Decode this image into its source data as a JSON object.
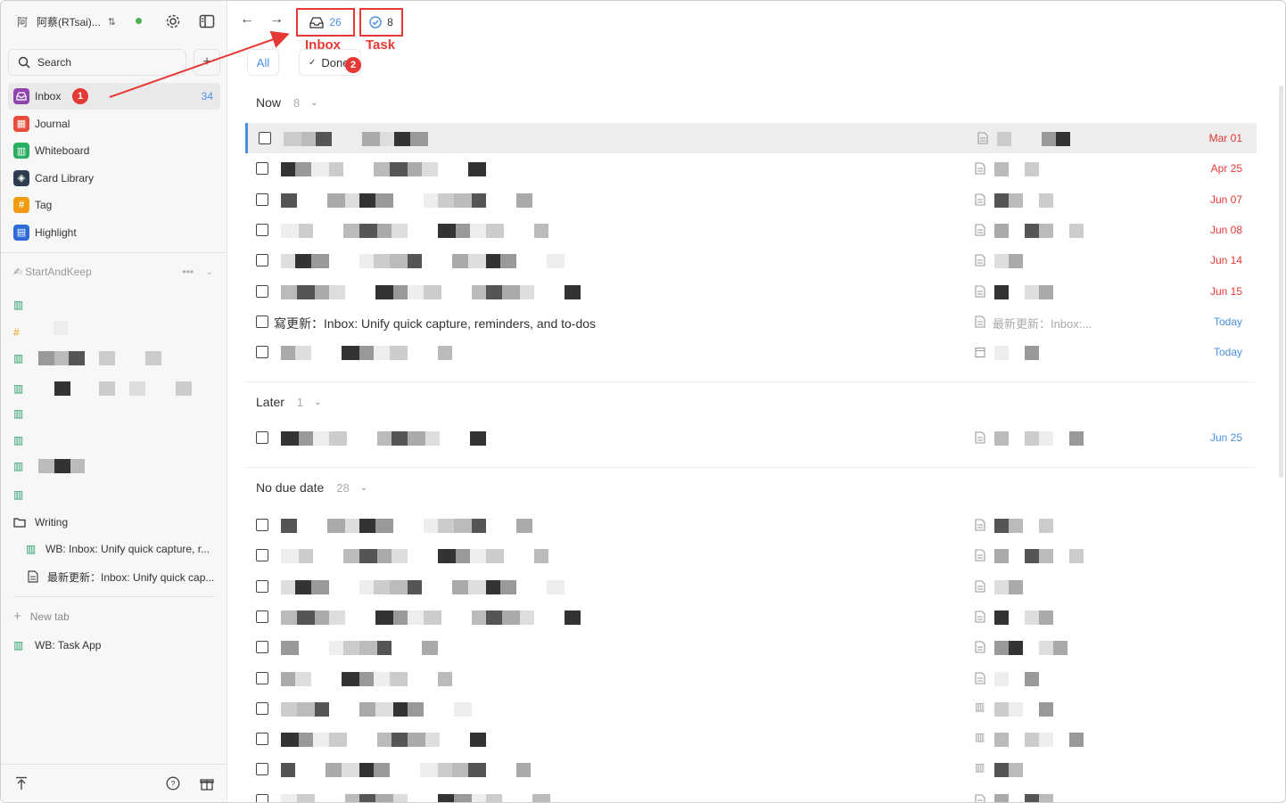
{
  "workspace": {
    "avatar": "阿",
    "name": "阿蔡(RTsai)..."
  },
  "search": {
    "label": "Search"
  },
  "sidebar": {
    "items": [
      {
        "label": "Inbox",
        "count": "34",
        "icon": "inbox-icon",
        "color": "#8e44ad"
      },
      {
        "label": "Journal",
        "icon": "journal-icon",
        "color": "#e74c3c"
      },
      {
        "label": "Whiteboard",
        "icon": "whiteboard-icon",
        "color": "#27ae60"
      },
      {
        "label": "Card Library",
        "icon": "card-library-icon",
        "color": "#2c3e50"
      },
      {
        "label": "Tag",
        "icon": "tag-icon",
        "color": "#f39c12"
      },
      {
        "label": "Highlight",
        "icon": "highlight-icon",
        "color": "#2e6bd9"
      }
    ],
    "section": "StartAndKeep",
    "folder": "Writing",
    "children": [
      "WB: Inbox: Unify quick capture, r...",
      "最新更新：Inbox: Unify quick cap..."
    ],
    "new_tab": "New tab",
    "tab_item": "WB: Task App"
  },
  "annotations": {
    "badge1": "1",
    "badge2": "2",
    "inbox_label": "Inbox",
    "task_label": "Task"
  },
  "header": {
    "inbox_count": "26",
    "task_count": "8"
  },
  "filters": {
    "all": "All",
    "done": "Done"
  },
  "groups": {
    "now": {
      "label": "Now",
      "count": "8"
    },
    "later": {
      "label": "Later",
      "count": "1"
    },
    "nodue": {
      "label": "No due date",
      "count": "28"
    }
  },
  "rows_now": [
    {
      "date": "Mar 01",
      "date_color": "#e53935"
    },
    {
      "date": "Apr 25",
      "date_color": "#e53935"
    },
    {
      "date": "Jun 07",
      "date_color": "#e53935"
    },
    {
      "date": "Jun 08",
      "date_color": "#e53935"
    },
    {
      "date": "Jun 14",
      "date_color": "#e53935"
    },
    {
      "date": "Jun 15",
      "date_color": "#e53935"
    },
    {
      "title": "寫更新：Inbox: Unify quick capture, reminders, and to-dos",
      "preview": "最新更新：Inbox:...",
      "date": "Today",
      "date_color": "#4a90e2"
    },
    {
      "date": "Today",
      "date_color": "#4a90e2"
    }
  ],
  "rows_later": [
    {
      "date": "Jun 25",
      "date_color": "#4a90e2"
    }
  ]
}
